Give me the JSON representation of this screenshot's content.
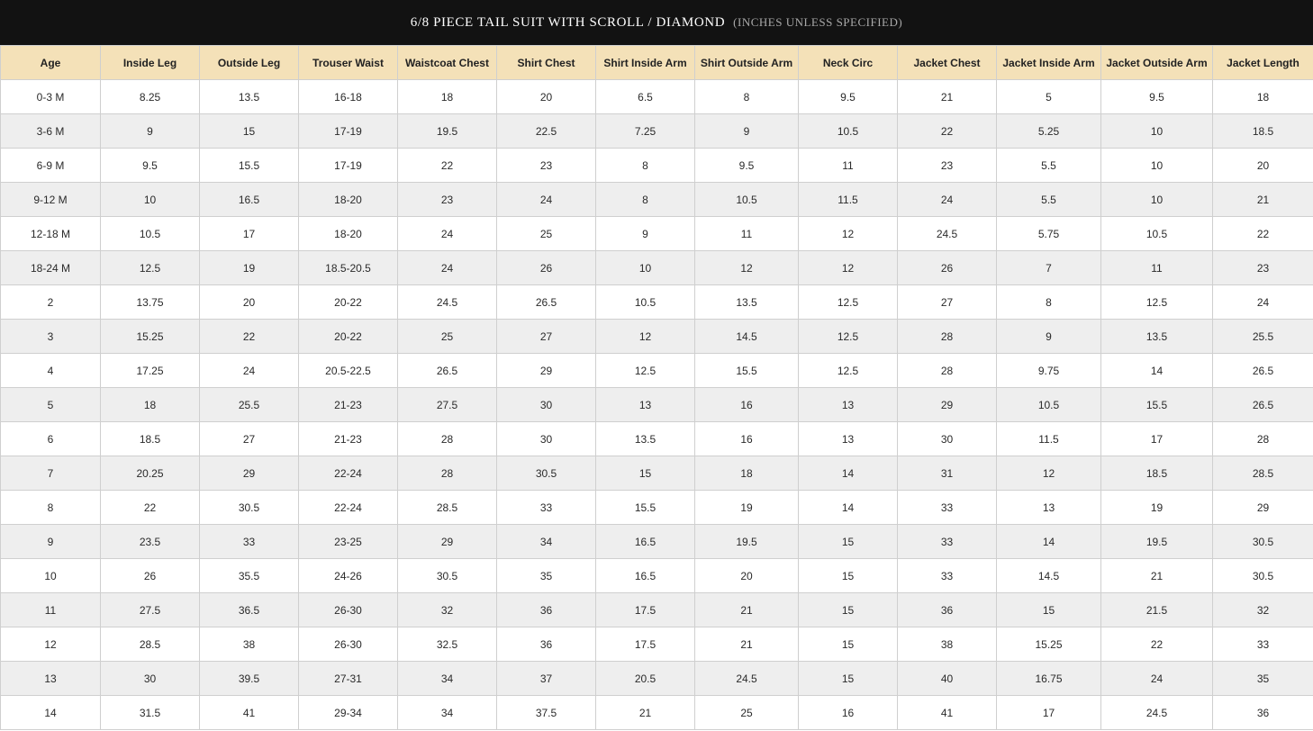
{
  "title": {
    "main": "6/8 PIECE TAIL SUIT WITH SCROLL / DIAMOND",
    "sub": "(INCHES UNLESS SPECIFIED)"
  },
  "table": {
    "headers": [
      "Age",
      "Inside Leg",
      "Outside Leg",
      "Trouser Waist",
      "Waistcoat Chest",
      "Shirt Chest",
      "Shirt Inside Arm",
      "Shirt Outside Arm",
      "Neck Circ",
      "Jacket Chest",
      "Jacket Inside Arm",
      "Jacket Outside Arm",
      "Jacket Length"
    ],
    "rows": [
      [
        "0-3 M",
        "8.25",
        "13.5",
        "16-18",
        "18",
        "20",
        "6.5",
        "8",
        "9.5",
        "21",
        "5",
        "9.5",
        "18"
      ],
      [
        "3-6 M",
        "9",
        "15",
        "17-19",
        "19.5",
        "22.5",
        "7.25",
        "9",
        "10.5",
        "22",
        "5.25",
        "10",
        "18.5"
      ],
      [
        "6-9 M",
        "9.5",
        "15.5",
        "17-19",
        "22",
        "23",
        "8",
        "9.5",
        "11",
        "23",
        "5.5",
        "10",
        "20"
      ],
      [
        "9-12 M",
        "10",
        "16.5",
        "18-20",
        "23",
        "24",
        "8",
        "10.5",
        "11.5",
        "24",
        "5.5",
        "10",
        "21"
      ],
      [
        "12-18 M",
        "10.5",
        "17",
        "18-20",
        "24",
        "25",
        "9",
        "11",
        "12",
        "24.5",
        "5.75",
        "10.5",
        "22"
      ],
      [
        "18-24 M",
        "12.5",
        "19",
        "18.5-20.5",
        "24",
        "26",
        "10",
        "12",
        "12",
        "26",
        "7",
        "11",
        "23"
      ],
      [
        "2",
        "13.75",
        "20",
        "20-22",
        "24.5",
        "26.5",
        "10.5",
        "13.5",
        "12.5",
        "27",
        "8",
        "12.5",
        "24"
      ],
      [
        "3",
        "15.25",
        "22",
        "20-22",
        "25",
        "27",
        "12",
        "14.5",
        "12.5",
        "28",
        "9",
        "13.5",
        "25.5"
      ],
      [
        "4",
        "17.25",
        "24",
        "20.5-22.5",
        "26.5",
        "29",
        "12.5",
        "15.5",
        "12.5",
        "28",
        "9.75",
        "14",
        "26.5"
      ],
      [
        "5",
        "18",
        "25.5",
        "21-23",
        "27.5",
        "30",
        "13",
        "16",
        "13",
        "29",
        "10.5",
        "15.5",
        "26.5"
      ],
      [
        "6",
        "18.5",
        "27",
        "21-23",
        "28",
        "30",
        "13.5",
        "16",
        "13",
        "30",
        "11.5",
        "17",
        "28"
      ],
      [
        "7",
        "20.25",
        "29",
        "22-24",
        "28",
        "30.5",
        "15",
        "18",
        "14",
        "31",
        "12",
        "18.5",
        "28.5"
      ],
      [
        "8",
        "22",
        "30.5",
        "22-24",
        "28.5",
        "33",
        "15.5",
        "19",
        "14",
        "33",
        "13",
        "19",
        "29"
      ],
      [
        "9",
        "23.5",
        "33",
        "23-25",
        "29",
        "34",
        "16.5",
        "19.5",
        "15",
        "33",
        "14",
        "19.5",
        "30.5"
      ],
      [
        "10",
        "26",
        "35.5",
        "24-26",
        "30.5",
        "35",
        "16.5",
        "20",
        "15",
        "33",
        "14.5",
        "21",
        "30.5"
      ],
      [
        "11",
        "27.5",
        "36.5",
        "26-30",
        "32",
        "36",
        "17.5",
        "21",
        "15",
        "36",
        "15",
        "21.5",
        "32"
      ],
      [
        "12",
        "28.5",
        "38",
        "26-30",
        "32.5",
        "36",
        "17.5",
        "21",
        "15",
        "38",
        "15.25",
        "22",
        "33"
      ],
      [
        "13",
        "30",
        "39.5",
        "27-31",
        "34",
        "37",
        "20.5",
        "24.5",
        "15",
        "40",
        "16.75",
        "24",
        "35"
      ],
      [
        "14",
        "31.5",
        "41",
        "29-34",
        "34",
        "37.5",
        "21",
        "25",
        "16",
        "41",
        "17",
        "24.5",
        "36"
      ]
    ]
  }
}
